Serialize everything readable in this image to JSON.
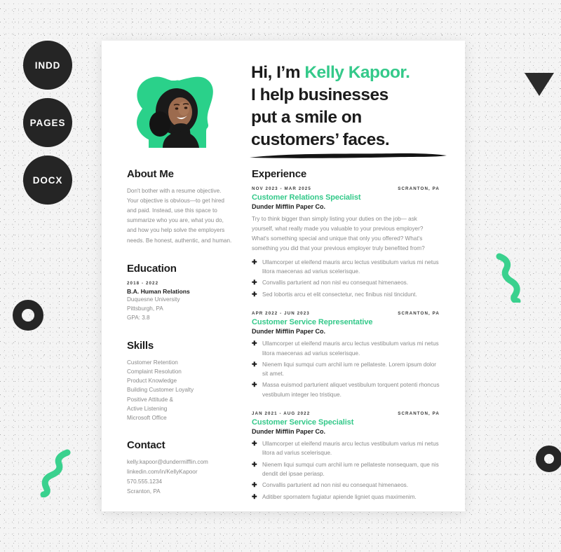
{
  "badges": [
    {
      "label": "INDD"
    },
    {
      "label": "PAGES"
    },
    {
      "label": "DOCX"
    }
  ],
  "colors": {
    "accent_green": "#34c98a",
    "blob_green": "#2ad18a",
    "ink": "#1c1c1c",
    "muted_text": "#8a8a8a",
    "badge_bg": "#252525",
    "page_bg": "#ffffff",
    "backdrop": "#f4f4f4"
  },
  "header": {
    "greeting": "Hi, I’m ",
    "name": "Kelly Kapoor.",
    "line2": "I help businesses",
    "line3": "put a smile on",
    "line4": "customers’ faces."
  },
  "about": {
    "title": "About Me",
    "text": "Don't bother with a resume objective. Your objective is obvious—to get hired and paid. Instead, use this space to summarize who you are, what you do, and how you help solve the employers needs. Be honest, authentic, and human."
  },
  "education": {
    "title": "Education",
    "dates": "2018 - 2022",
    "degree": "B.A. Human Relations",
    "school": "Duquesne University",
    "location": "Pittsburgh, PA",
    "gpa": "GPA: 3.8"
  },
  "skills": {
    "title": "Skills",
    "items": [
      "Customer Retention",
      "Complaint Resolution",
      "Product Knowledge",
      "Building Customer Loyalty",
      "Positive Attitude &",
      "Active Listening",
      "Microsoft Office"
    ]
  },
  "contact": {
    "title": "Contact",
    "email": "kelly.kapoor@dundermifflin.com",
    "linkedin": "linkedin.com/in/KellyKapoor",
    "phone": "570.555.1234",
    "location": "Scranton, PA"
  },
  "experience": {
    "title": "Experience",
    "jobs": [
      {
        "dates": "NOV 2023 - MAR 2025",
        "location": "SCRANTON, PA",
        "title": "Customer Relations Specialist",
        "company": "Dunder Mifflin Paper Co.",
        "intro": "Try to think bigger than simply listing your duties on the job— ask yourself, what really made you valuable to your previous employer? What's something special and unique that only you offered? What's something you did that your previous employer truly benefited from?",
        "bullets": [
          "Ullamcorper ut eleifend mauris arcu lectus vestibulum varius mi netus litora maecenas ad varius scelerisque.",
          "Convallis parturient ad non nisl eu consequat himenaeos.",
          "Sed lobortis arcu et elit consectetur, nec finibus nisl tincidunt."
        ]
      },
      {
        "dates": "APR 2022 - JUN 2023",
        "location": "SCRANTON, PA",
        "title": "Customer Service Representative",
        "company": "Dunder Mifflin Paper Co.",
        "intro": "",
        "bullets": [
          "Ullamcorper ut eleifend mauris arcu lectus vestibulum varius mi netus litora maecenas ad varius scelerisque.",
          "Nienem liqui sumqui cum archil ium re pellateste. Lorem ipsum dolor sit amet.",
          "Massa euismod parturient aliquet vestibulum torquent potenti rhoncus vestibulum integer leo tristique."
        ]
      },
      {
        "dates": "JAN 2021 - AUG 2022",
        "location": "SCRANTON, PA",
        "title": "Customer Service Specialist",
        "company": "Dunder Mifflin Paper Co.",
        "intro": "",
        "bullets": [
          "Ullamcorper ut eleifend mauris arcu lectus vestibulum varius mi netus litora ad varius scelerisque.",
          "Nienem liqui sumqui cum archil ium re pellateste nonsequam, que nis dendit del ipsae periasp.",
          "Convallis parturient ad non nisl eu consequat himenaeos.",
          "Aditiber spornatem fugiatur apiende ligniet quas maximenim."
        ]
      }
    ]
  },
  "decorations": {
    "triangle": "triangle-down",
    "ring_left": "ring",
    "ring_right": "ring",
    "squiggle_left": "squiggle",
    "squiggle_right": "squiggle"
  }
}
